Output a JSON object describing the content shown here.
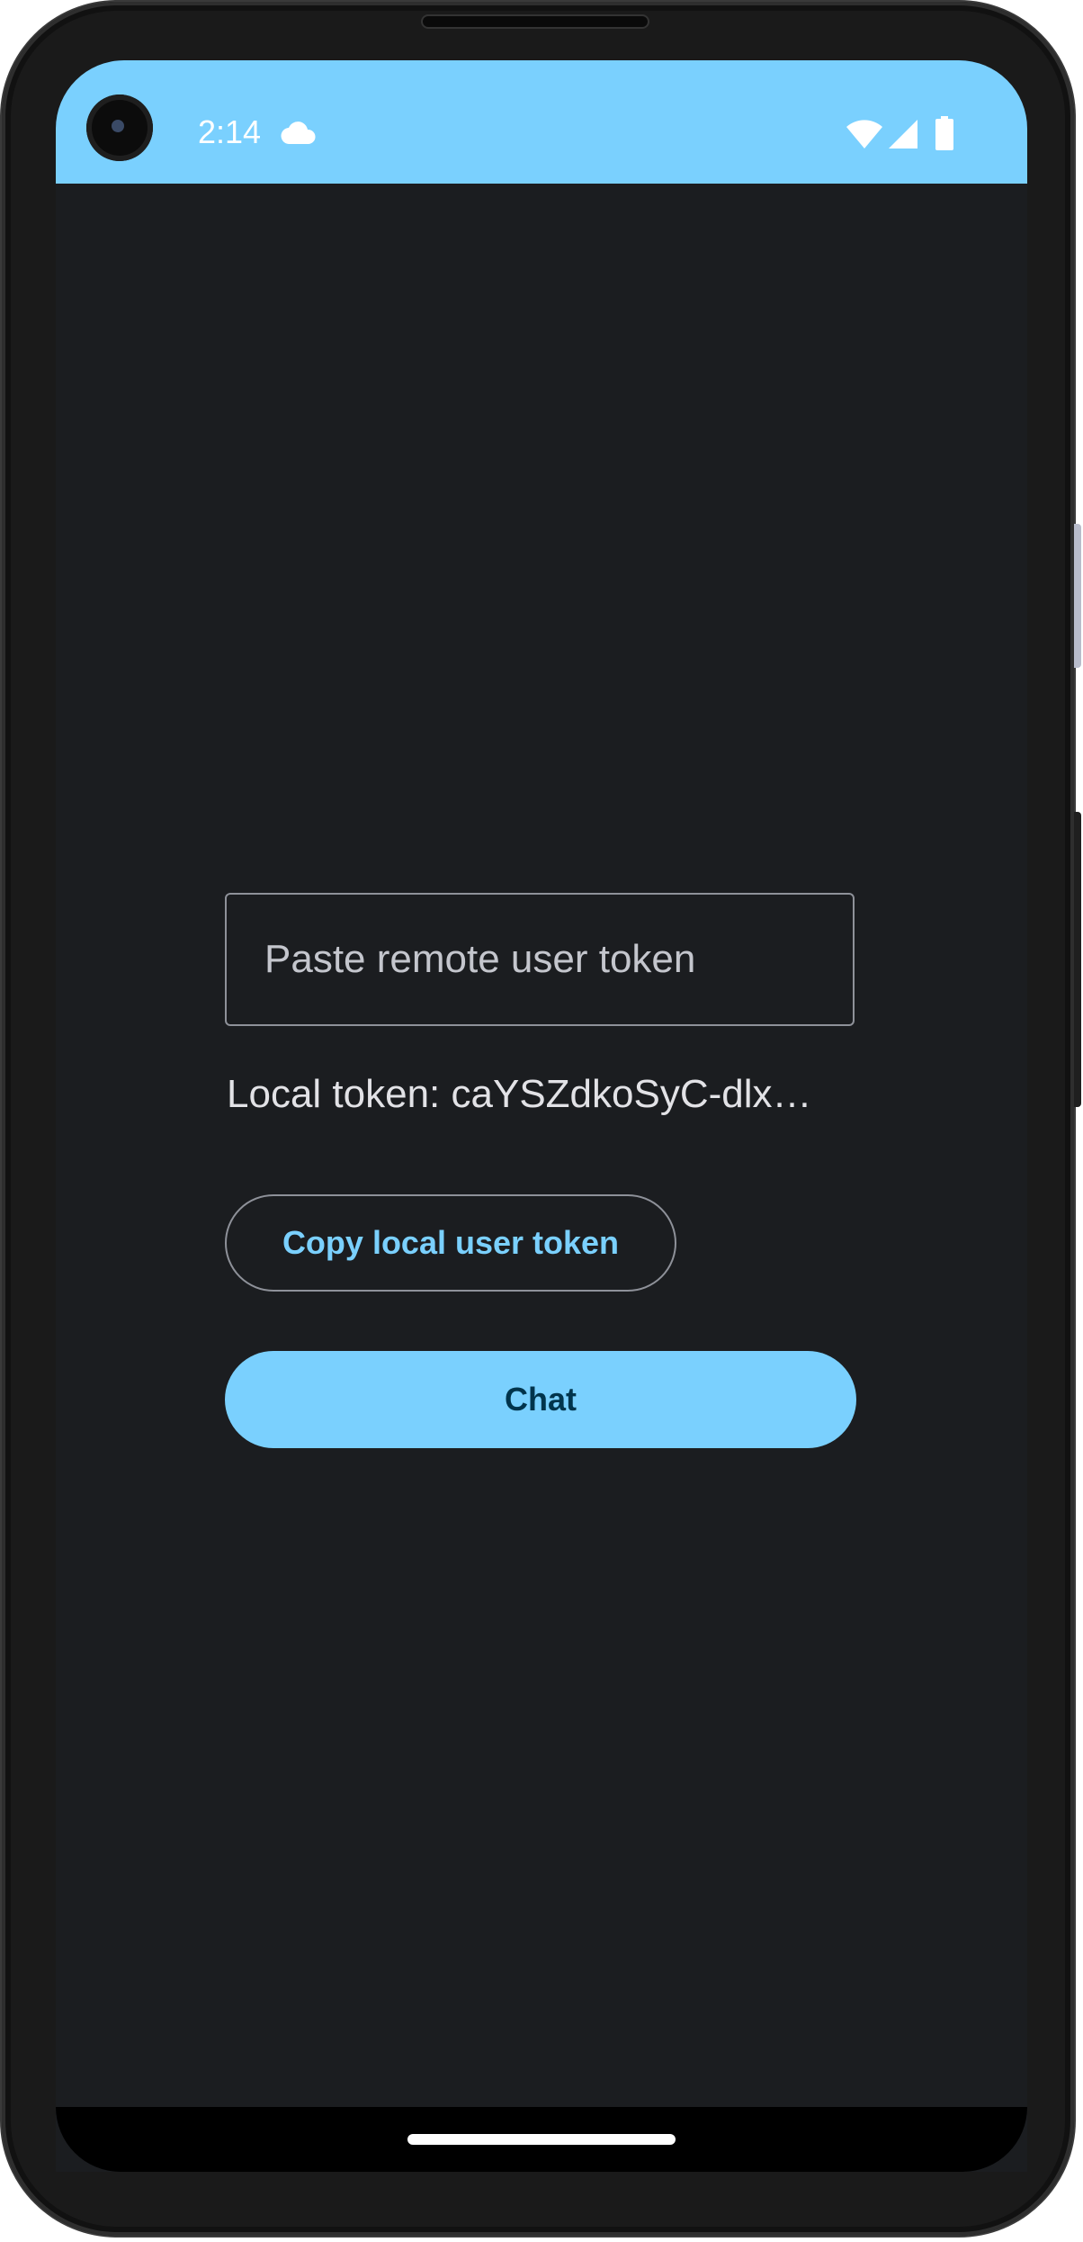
{
  "status_bar": {
    "time": "2:14",
    "background_color": "#7ad0fe",
    "icons": [
      "cloud-icon",
      "wifi-icon",
      "cellular-signal-icon",
      "battery-icon"
    ]
  },
  "main": {
    "remote_token_input": {
      "placeholder": "Paste remote user token",
      "value": ""
    },
    "local_token_label": "Local token: caYSZdkoSyC-dlx…",
    "copy_button_label": "Copy local user token",
    "chat_button_label": "Chat"
  },
  "colors": {
    "accent": "#7ad0fe",
    "background": "#1b1d20",
    "outline": "#8e9199",
    "on_accent": "#00344c"
  }
}
